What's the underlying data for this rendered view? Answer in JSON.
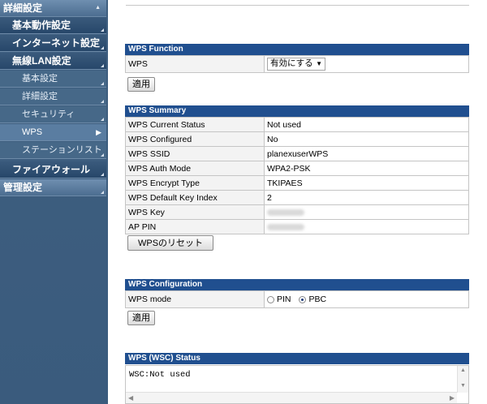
{
  "sidebar": {
    "items": [
      {
        "label": "詳細設定",
        "level": 0
      },
      {
        "label": "基本動作設定",
        "level": 1
      },
      {
        "label": "インターネット設定",
        "level": 1
      },
      {
        "label": "無線LAN設定",
        "level": 1
      },
      {
        "label": "基本設定",
        "level": 2
      },
      {
        "label": "詳細設定",
        "level": 2
      },
      {
        "label": "セキュリティ",
        "level": 2
      },
      {
        "label": "WPS",
        "level": 2,
        "selected": true
      },
      {
        "label": "ステーションリスト",
        "level": 2
      },
      {
        "label": "ファイアウォール",
        "level": 1
      },
      {
        "label": "管理設定",
        "level": 0
      }
    ]
  },
  "wps_function": {
    "title": "WPS Function",
    "label": "WPS",
    "value": "有効にする",
    "apply_label": "適用"
  },
  "wps_summary": {
    "title": "WPS Summary",
    "rows": [
      {
        "label": "WPS Current Status",
        "value": "Not used"
      },
      {
        "label": "WPS Configured",
        "value": "No"
      },
      {
        "label": "WPS SSID",
        "value": "planexuserWPS"
      },
      {
        "label": "WPS Auth Mode",
        "value": "WPA2-PSK"
      },
      {
        "label": "WPS Encrypt Type",
        "value": "TKIPAES"
      },
      {
        "label": "WPS Default Key Index",
        "value": "2"
      },
      {
        "label": "WPS Key",
        "value": ""
      },
      {
        "label": "AP PIN",
        "value": ""
      }
    ],
    "reset_label": "WPSのリセット"
  },
  "wps_configuration": {
    "title": "WPS Configuration",
    "label": "WPS mode",
    "options": [
      "PIN",
      "PBC"
    ],
    "selected": "PBC",
    "apply_label": "適用"
  },
  "wps_status": {
    "title": "WPS (WSC) Status",
    "text": "WSC:Not used"
  },
  "colors": {
    "sidebar": "#3f5f80",
    "section_header": "#204f8f"
  }
}
